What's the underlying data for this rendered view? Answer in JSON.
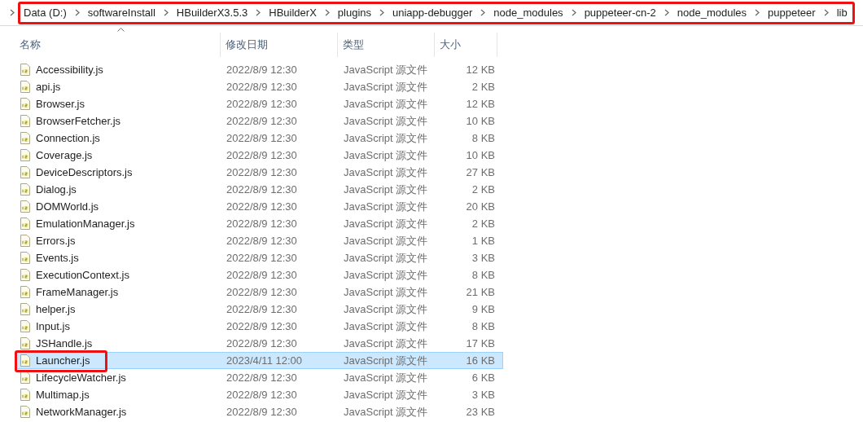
{
  "breadcrumb": {
    "annotated": true,
    "segments": [
      "Data (D:)",
      "softwareInstall",
      "HBuilderX3.5.3",
      "HBuilderX",
      "plugins",
      "uniapp-debugger",
      "node_modules",
      "puppeteer-cn-2",
      "node_modules",
      "puppeteer",
      "lib"
    ]
  },
  "columns": [
    {
      "label": "名称",
      "sorted": true
    },
    {
      "label": "修改日期",
      "sorted": false
    },
    {
      "label": "类型",
      "sorted": false
    },
    {
      "label": "大小",
      "sorted": false
    }
  ],
  "rows": [
    {
      "name": "Accessibility.js",
      "date": "2022/8/9 12:30",
      "type": "JavaScript 源文件",
      "size": "12 KB",
      "selected": false,
      "annotated": false
    },
    {
      "name": "api.js",
      "date": "2022/8/9 12:30",
      "type": "JavaScript 源文件",
      "size": "2 KB",
      "selected": false,
      "annotated": false
    },
    {
      "name": "Browser.js",
      "date": "2022/8/9 12:30",
      "type": "JavaScript 源文件",
      "size": "12 KB",
      "selected": false,
      "annotated": false
    },
    {
      "name": "BrowserFetcher.js",
      "date": "2022/8/9 12:30",
      "type": "JavaScript 源文件",
      "size": "10 KB",
      "selected": false,
      "annotated": false
    },
    {
      "name": "Connection.js",
      "date": "2022/8/9 12:30",
      "type": "JavaScript 源文件",
      "size": "8 KB",
      "selected": false,
      "annotated": false
    },
    {
      "name": "Coverage.js",
      "date": "2022/8/9 12:30",
      "type": "JavaScript 源文件",
      "size": "10 KB",
      "selected": false,
      "annotated": false
    },
    {
      "name": "DeviceDescriptors.js",
      "date": "2022/8/9 12:30",
      "type": "JavaScript 源文件",
      "size": "27 KB",
      "selected": false,
      "annotated": false
    },
    {
      "name": "Dialog.js",
      "date": "2022/8/9 12:30",
      "type": "JavaScript 源文件",
      "size": "2 KB",
      "selected": false,
      "annotated": false
    },
    {
      "name": "DOMWorld.js",
      "date": "2022/8/9 12:30",
      "type": "JavaScript 源文件",
      "size": "20 KB",
      "selected": false,
      "annotated": false
    },
    {
      "name": "EmulationManager.js",
      "date": "2022/8/9 12:30",
      "type": "JavaScript 源文件",
      "size": "2 KB",
      "selected": false,
      "annotated": false
    },
    {
      "name": "Errors.js",
      "date": "2022/8/9 12:30",
      "type": "JavaScript 源文件",
      "size": "1 KB",
      "selected": false,
      "annotated": false
    },
    {
      "name": "Events.js",
      "date": "2022/8/9 12:30",
      "type": "JavaScript 源文件",
      "size": "3 KB",
      "selected": false,
      "annotated": false
    },
    {
      "name": "ExecutionContext.js",
      "date": "2022/8/9 12:30",
      "type": "JavaScript 源文件",
      "size": "8 KB",
      "selected": false,
      "annotated": false
    },
    {
      "name": "FrameManager.js",
      "date": "2022/8/9 12:30",
      "type": "JavaScript 源文件",
      "size": "21 KB",
      "selected": false,
      "annotated": false
    },
    {
      "name": "helper.js",
      "date": "2022/8/9 12:30",
      "type": "JavaScript 源文件",
      "size": "9 KB",
      "selected": false,
      "annotated": false
    },
    {
      "name": "Input.js",
      "date": "2022/8/9 12:30",
      "type": "JavaScript 源文件",
      "size": "8 KB",
      "selected": false,
      "annotated": false
    },
    {
      "name": "JSHandle.js",
      "date": "2022/8/9 12:30",
      "type": "JavaScript 源文件",
      "size": "17 KB",
      "selected": false,
      "annotated": false
    },
    {
      "name": "Launcher.js",
      "date": "2023/4/11 12:00",
      "type": "JavaScript 源文件",
      "size": "16 KB",
      "selected": true,
      "annotated": true
    },
    {
      "name": "LifecycleWatcher.js",
      "date": "2022/8/9 12:30",
      "type": "JavaScript 源文件",
      "size": "6 KB",
      "selected": false,
      "annotated": false
    },
    {
      "name": "Multimap.js",
      "date": "2022/8/9 12:30",
      "type": "JavaScript 源文件",
      "size": "3 KB",
      "selected": false,
      "annotated": false
    },
    {
      "name": "NetworkManager.js",
      "date": "2022/8/9 12:30",
      "type": "JavaScript 源文件",
      "size": "23 KB",
      "selected": false,
      "annotated": false
    }
  ]
}
